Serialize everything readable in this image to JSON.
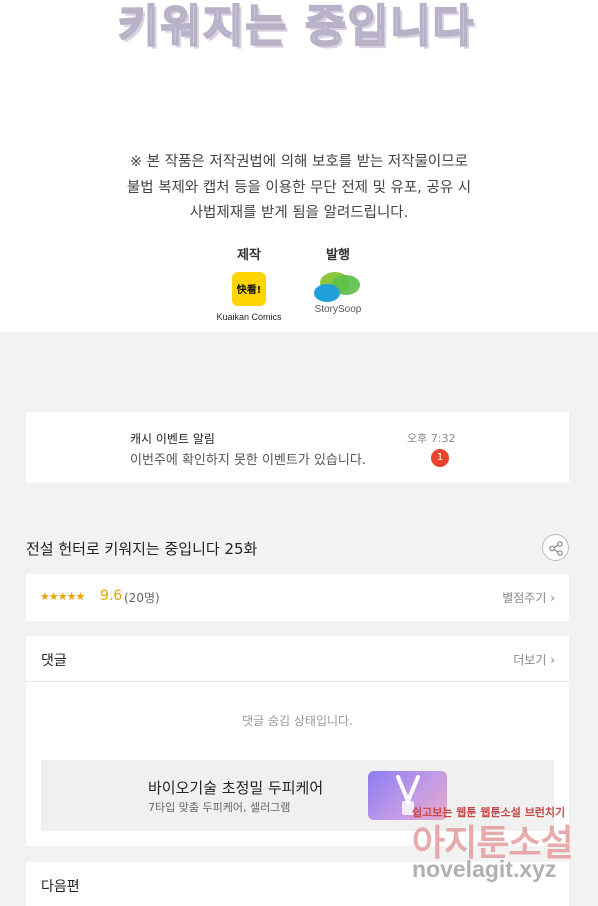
{
  "banner": {
    "title_partial": "키워지는 중입니다"
  },
  "notice": {
    "line1": "※ 본 작품은 저작권법에 의해 보호를 받는 저작물이므로",
    "line2": "불법 복제와 캡처 등을 이용한 무단 전제 및 유포, 공유 시",
    "line3": "사법제재를 받게 됨을 알려드립니다."
  },
  "credits": {
    "production_label": "제작",
    "production_logo_text": "快看!",
    "production_name": "Kuaikan Comics",
    "publisher_label": "발행",
    "publisher_name": "StorySoop"
  },
  "event": {
    "title": "캐시 이벤트 알림",
    "message": "이번주에 확인하지 못한 이벤트가 있습니다.",
    "time": "오후 7:32",
    "badge": "1"
  },
  "episode": {
    "title": "전설 헌터로 키워지는 중입니다 25화"
  },
  "rating": {
    "stars": "★★★★★",
    "score": "9.6",
    "count": "(20명)",
    "rate_label": "별점주기 ›"
  },
  "comments": {
    "title": "댓글",
    "more_label": "더보기 ›",
    "hidden_message": "댓글 숨김 상태입니다."
  },
  "ad": {
    "title": "바이오기술 초정밀 두피케어",
    "subtitle": "7타입 맞춤 두피케어, 셀러그램"
  },
  "next": {
    "title": "다음편"
  },
  "watermark": {
    "top": "쉽고보는 웹툰 웹툰소설 브런치기",
    "main": "아지툰소설",
    "url": "novelagit.xyz"
  }
}
